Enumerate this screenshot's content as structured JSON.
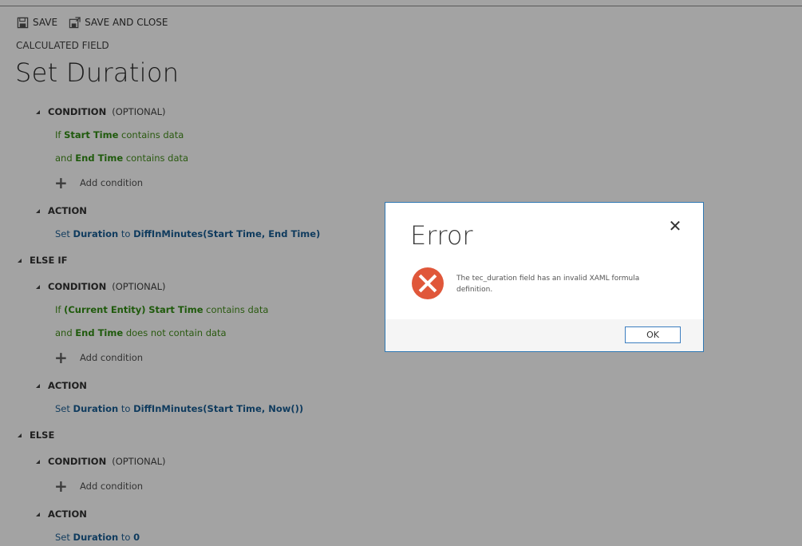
{
  "toolbar": {
    "save_label": "SAVE",
    "save_close_label": "SAVE AND CLOSE"
  },
  "header": {
    "entity_label": "CALCULATED FIELD",
    "title": "Set Duration"
  },
  "editor": {
    "condition_label": "CONDITION",
    "optional_label": "(OPTIONAL)",
    "action_label": "ACTION",
    "else_if_label": "ELSE IF",
    "else_label": "ELSE",
    "add_condition_label": "Add condition",
    "block1": {
      "cond1": {
        "prefix": "If",
        "field": "Start Time",
        "op": "contains data"
      },
      "cond2": {
        "prefix": "and",
        "field": "End Time",
        "op": "contains data"
      },
      "action": {
        "prefix": "Set",
        "field": "Duration",
        "to": "to",
        "value": "DiffInMinutes(Start Time, End Time)"
      }
    },
    "block2": {
      "cond1": {
        "prefix": "If",
        "entity": "(Current Entity)",
        "field": "Start Time",
        "op": "contains data"
      },
      "cond2": {
        "prefix": "and",
        "field": "End Time",
        "op": "does not contain data"
      },
      "action": {
        "prefix": "Set",
        "field": "Duration",
        "to": "to",
        "value": "DiffInMinutes(Start Time, Now())"
      }
    },
    "block3": {
      "action": {
        "prefix": "Set",
        "field": "Duration",
        "to": "to",
        "value": "0"
      }
    }
  },
  "dialog": {
    "title": "Error",
    "message": "The tec_duration field has an invalid XAML formula definition.",
    "ok_label": "OK",
    "close_glyph": "✕"
  },
  "icons": {
    "save": "save-icon",
    "save_close": "save-and-close-icon",
    "error": "error-icon",
    "collapse": "collapse-triangle-icon",
    "add": "plus-icon"
  },
  "colors": {
    "overlay": "#a3a3a3",
    "field_green": "#1f5a0c",
    "field_blue": "#0f3b5e",
    "dialog_border": "#2f78b3",
    "error_red": "#e0573a"
  }
}
